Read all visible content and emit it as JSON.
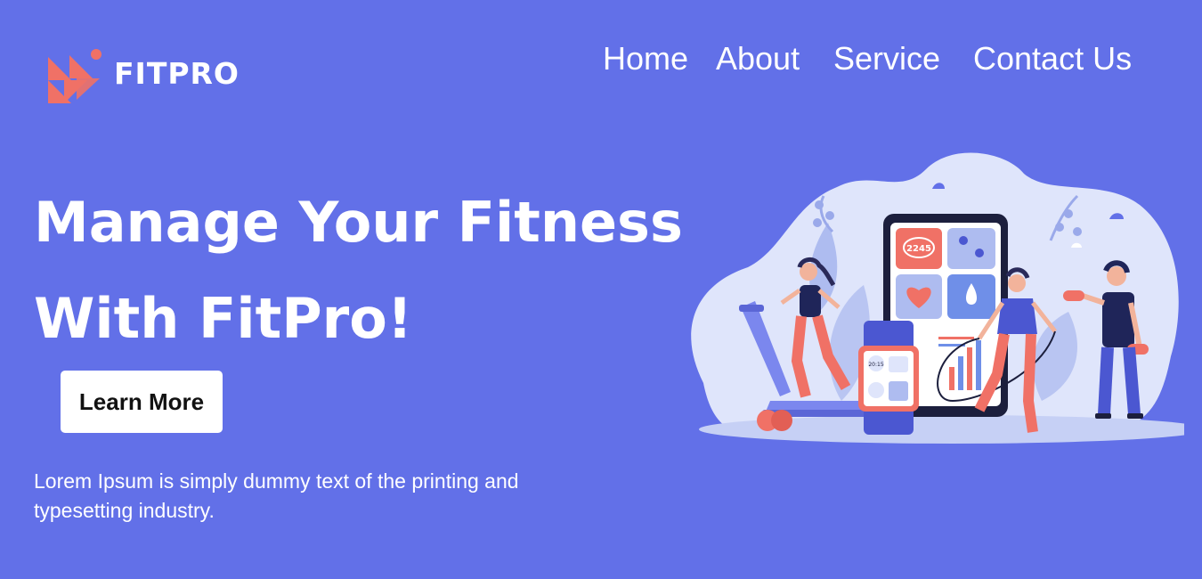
{
  "brand": {
    "name": "FITPRO",
    "logo_icon": "fitpro-triangles-logo",
    "accent_color": "#f07166",
    "background_color": "#6270e8"
  },
  "nav": {
    "items": [
      {
        "label": "Home"
      },
      {
        "label": "About"
      },
      {
        "label": "Service"
      },
      {
        "label": "Contact Us"
      }
    ]
  },
  "hero": {
    "title_line_1": "Manage Your Fitness",
    "title_line_2": "With FitPro!",
    "cta_label": "Learn More",
    "description": "Lorem Ipsum is simply dummy text of the printing and typesetting industry."
  },
  "illustration": {
    "icon": "fitness-app-illustration",
    "phone_stat": "2245",
    "watch_time": "20:15"
  }
}
